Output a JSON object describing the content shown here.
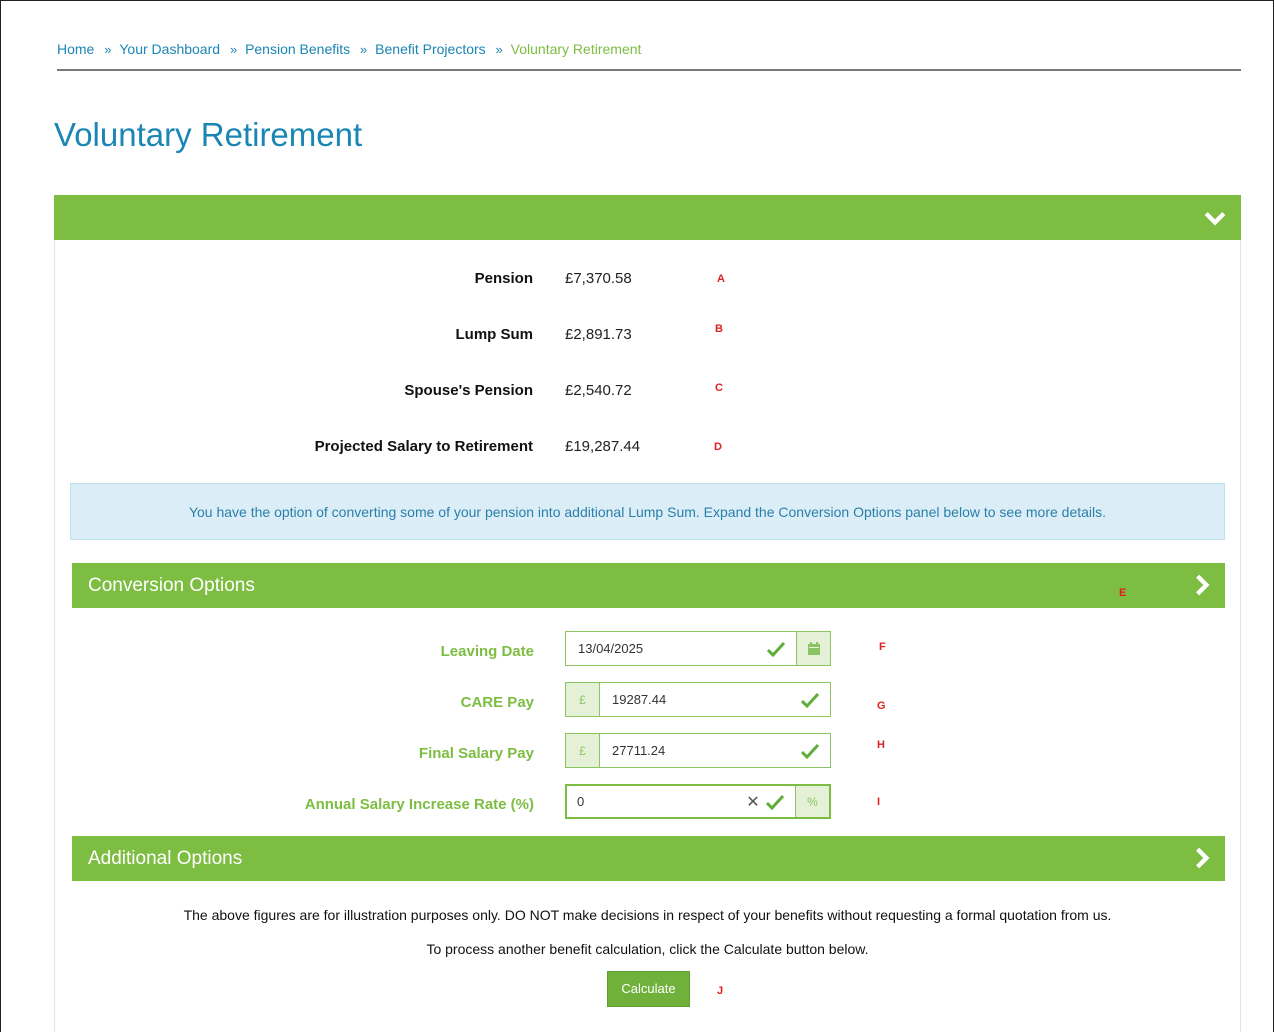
{
  "breadcrumb": {
    "items": [
      "Home",
      "Your Dashboard",
      "Pension Benefits",
      "Benefit Projectors",
      "Voluntary Retirement"
    ],
    "separator": "»"
  },
  "page_title": "Voluntary Retirement",
  "results": [
    {
      "label": "Pension",
      "value": "£7,370.58",
      "marker": "A"
    },
    {
      "label": "Lump Sum",
      "value": "£2,891.73",
      "marker": "B"
    },
    {
      "label": "Spouse's Pension",
      "value": "£2,540.72",
      "marker": "C"
    },
    {
      "label": "Projected Salary to Retirement",
      "value": "£19,287.44",
      "marker": "D"
    }
  ],
  "info_message": "You have the option of converting some of your pension into additional Lump Sum. Expand the Conversion Options panel below to see more details.",
  "conversion_options": {
    "title": "Conversion Options",
    "marker": "E"
  },
  "form": {
    "leaving_date": {
      "label": "Leaving Date",
      "value": "13/04/2025",
      "marker": "F"
    },
    "care_pay": {
      "label": "CARE Pay",
      "prefix": "£",
      "value": "19287.44",
      "marker": "G"
    },
    "final_salary_pay": {
      "label": "Final Salary Pay",
      "prefix": "£",
      "value": "27711.24",
      "marker": "H"
    },
    "salary_increase": {
      "label": "Annual Salary Increase Rate (%)",
      "value": "0",
      "suffix": "%",
      "marker": "I"
    }
  },
  "additional_options": {
    "title": "Additional Options"
  },
  "notes": {
    "disclaimer": "The above figures are for illustration purposes only. DO NOT make decisions in respect of your benefits without requesting a formal quotation from us.",
    "instruction": "To process another benefit calculation, click the Calculate button below."
  },
  "calculate_button": {
    "label": "Calculate",
    "marker": "J"
  },
  "colors": {
    "accent_green": "#7dbd42",
    "link_blue": "#1a86b4",
    "marker_red": "#e02020",
    "info_bg": "#dbeef7"
  }
}
